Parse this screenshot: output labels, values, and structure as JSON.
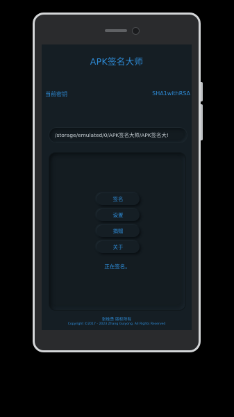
{
  "app": {
    "title": "APK签名大师"
  },
  "info": {
    "current_key_label": "当前密钥",
    "algorithm": "SHA1withRSA"
  },
  "path_field": {
    "value": "/storage/emulated/0/APK签名大师/APK签名大!"
  },
  "menu": {
    "sign_label": "签名",
    "settings_label": "设置",
    "donate_label": "捐赠",
    "about_label": "关于"
  },
  "status": {
    "text": "正在签名。"
  },
  "footer": {
    "author": "张桂勇 版权所有",
    "copyright": "Copyright ©2017 - 2023 Zhang Guiyong. All Rights Reserved"
  },
  "colors": {
    "accent": "#2e8bd6",
    "screen_bg": "#151e24",
    "device_frame": "#d4d6d8",
    "bezel": "#2a2b2d"
  }
}
